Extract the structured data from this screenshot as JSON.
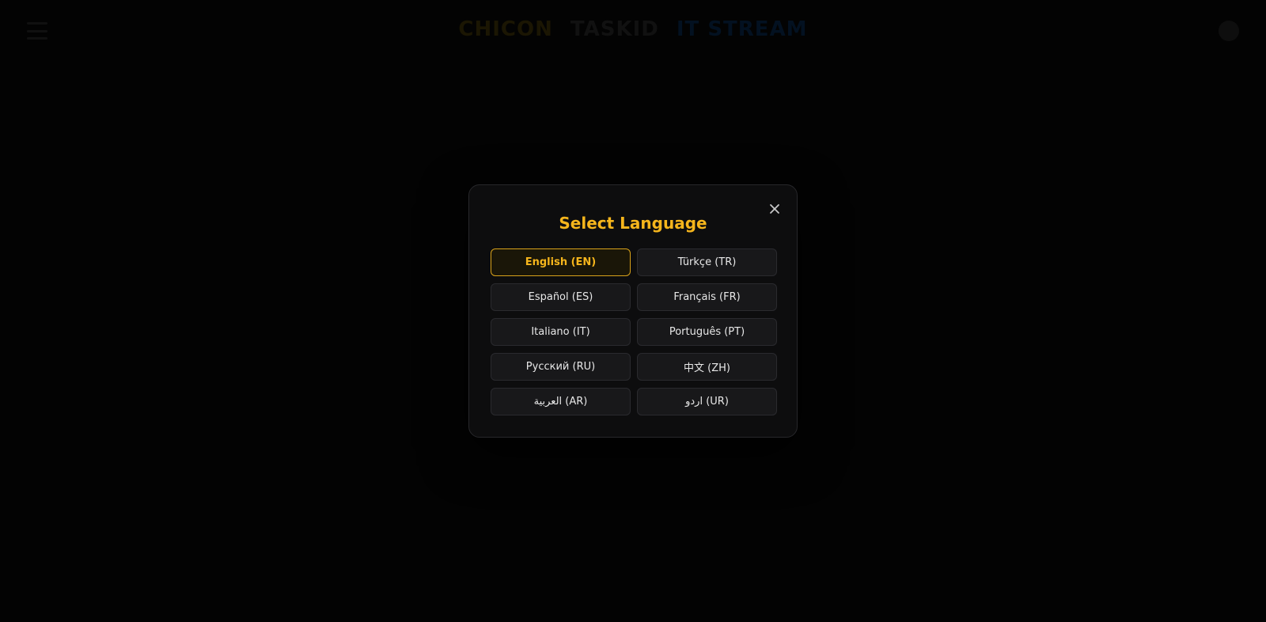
{
  "background": {
    "logo_words": [
      "CHICON",
      "TASKID",
      "IT STREAM"
    ]
  },
  "modal": {
    "title": "Select Language",
    "close_icon": "close-icon",
    "selected_index": 0,
    "accent_color": "#f5b51c",
    "languages": [
      {
        "label": "English (EN)",
        "selected": true
      },
      {
        "label": "Türkçe (TR)",
        "selected": false
      },
      {
        "label": "Español (ES)",
        "selected": false
      },
      {
        "label": "Français (FR)",
        "selected": false
      },
      {
        "label": "Italiano (IT)",
        "selected": false
      },
      {
        "label": "Português (PT)",
        "selected": false
      },
      {
        "label": "Русский (RU)",
        "selected": false
      },
      {
        "label": "中文 (ZH)",
        "selected": false
      },
      {
        "label": "العربية (AR)",
        "selected": false
      },
      {
        "label": "اردو (UR)",
        "selected": false
      }
    ]
  }
}
